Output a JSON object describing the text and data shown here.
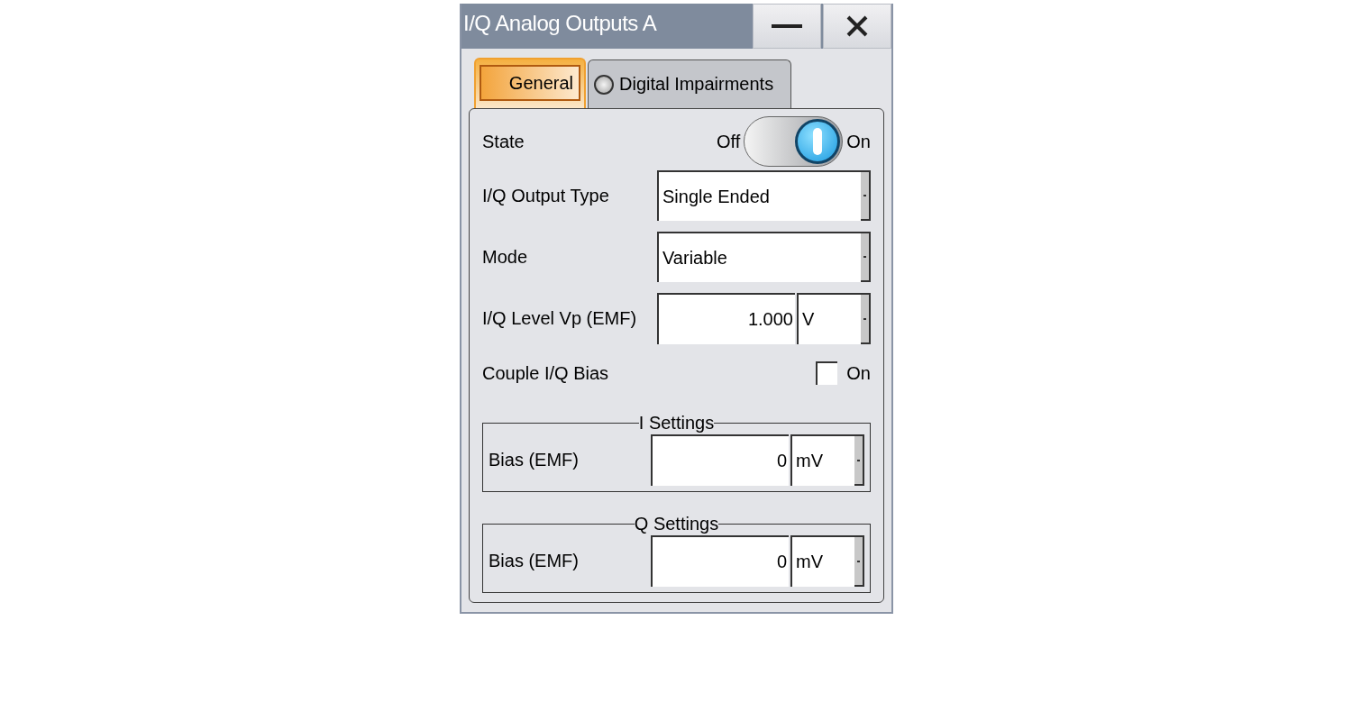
{
  "window": {
    "title": "I/Q Analog Outputs A",
    "buttons": [
      {
        "kind": "minimize"
      },
      {
        "kind": "close"
      }
    ]
  },
  "tabs": [
    {
      "label": "General",
      "selected": true
    },
    {
      "label": "Digital Impairments",
      "selected": false,
      "indicator_on": false
    }
  ],
  "rows": [
    {
      "kind": "toggle",
      "label": "State",
      "off_label": "Off",
      "on_label": "On",
      "on": true
    },
    {
      "kind": "dropdown",
      "label": "I/Q Output Type",
      "value": "Single Ended"
    },
    {
      "kind": "dropdown",
      "label": "Mode",
      "value": "Variable"
    },
    {
      "kind": "number",
      "label": "I/Q Level Vp (EMF)",
      "value": "1.000",
      "unit": "V"
    },
    {
      "kind": "checkbox",
      "label": "Couple I/Q Bias",
      "option": "On",
      "checked": false
    }
  ],
  "groups": [
    {
      "title": "I Settings",
      "rows": [
        {
          "kind": "number",
          "label": "Bias (EMF)",
          "value": "0",
          "unit": "mV"
        }
      ]
    },
    {
      "title": "Q Settings",
      "rows": [
        {
          "kind": "number",
          "label": "Bias (EMF)",
          "value": "0",
          "unit": "mV"
        }
      ]
    }
  ]
}
